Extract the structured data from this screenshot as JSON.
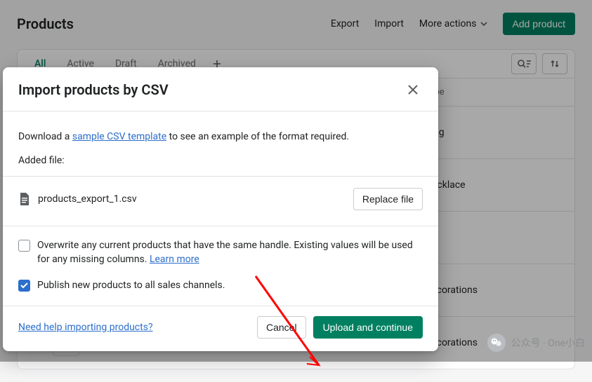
{
  "header": {
    "title": "Products",
    "export": "Export",
    "import": "Import",
    "more_actions": "More actions",
    "add_product": "Add product"
  },
  "tabs": {
    "items": [
      {
        "label": "All",
        "active": true
      },
      {
        "label": "Active",
        "active": false
      },
      {
        "label": "Draft",
        "active": false
      },
      {
        "label": "Archived",
        "active": false
      }
    ],
    "add_icon": "plus"
  },
  "columns": {
    "type": "Type"
  },
  "rows": [
    {
      "type": "Ring"
    },
    {
      "type": "Necklace"
    },
    {
      "type": ""
    },
    {
      "type": "Decorations"
    },
    {
      "type": "Decorations"
    }
  ],
  "modal": {
    "title": "Import products by CSV",
    "download_prefix": "Download a ",
    "sample_link": "sample CSV template",
    "download_suffix": " to see an example of the format required.",
    "added_file_label": "Added file:",
    "file_name": "products_export_1.csv",
    "replace_button": "Replace file",
    "overwrite_text_a": "Overwrite any current products that have the same handle. Existing values will be used for any missing columns. ",
    "learn_more": "Learn more",
    "publish_text": "Publish new products to all sales channels.",
    "help_link": "Need help importing products?",
    "cancel": "Cancel",
    "upload": "Upload and continue"
  },
  "watermark": {
    "text": "公众号 · One小白"
  }
}
